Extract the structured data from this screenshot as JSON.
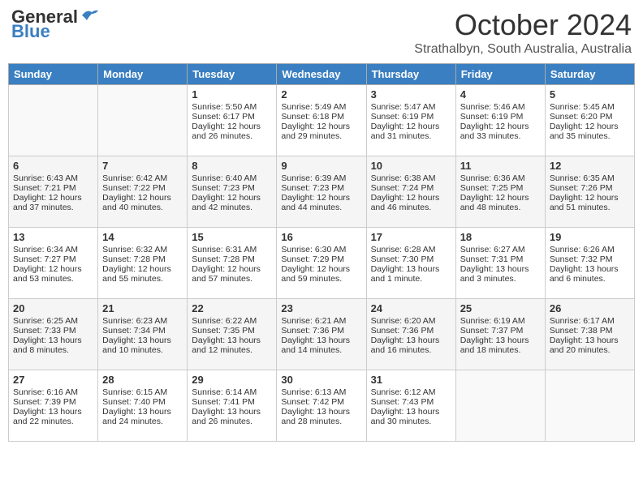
{
  "logo": {
    "general": "General",
    "blue": "Blue"
  },
  "header": {
    "month": "October 2024",
    "location": "Strathalbyn, South Australia, Australia"
  },
  "weekdays": [
    "Sunday",
    "Monday",
    "Tuesday",
    "Wednesday",
    "Thursday",
    "Friday",
    "Saturday"
  ],
  "weeks": [
    [
      {
        "day": "",
        "info": ""
      },
      {
        "day": "",
        "info": ""
      },
      {
        "day": "1",
        "info": "Sunrise: 5:50 AM\nSunset: 6:17 PM\nDaylight: 12 hours\nand 26 minutes."
      },
      {
        "day": "2",
        "info": "Sunrise: 5:49 AM\nSunset: 6:18 PM\nDaylight: 12 hours\nand 29 minutes."
      },
      {
        "day": "3",
        "info": "Sunrise: 5:47 AM\nSunset: 6:19 PM\nDaylight: 12 hours\nand 31 minutes."
      },
      {
        "day": "4",
        "info": "Sunrise: 5:46 AM\nSunset: 6:19 PM\nDaylight: 12 hours\nand 33 minutes."
      },
      {
        "day": "5",
        "info": "Sunrise: 5:45 AM\nSunset: 6:20 PM\nDaylight: 12 hours\nand 35 minutes."
      }
    ],
    [
      {
        "day": "6",
        "info": "Sunrise: 6:43 AM\nSunset: 7:21 PM\nDaylight: 12 hours\nand 37 minutes."
      },
      {
        "day": "7",
        "info": "Sunrise: 6:42 AM\nSunset: 7:22 PM\nDaylight: 12 hours\nand 40 minutes."
      },
      {
        "day": "8",
        "info": "Sunrise: 6:40 AM\nSunset: 7:23 PM\nDaylight: 12 hours\nand 42 minutes."
      },
      {
        "day": "9",
        "info": "Sunrise: 6:39 AM\nSunset: 7:23 PM\nDaylight: 12 hours\nand 44 minutes."
      },
      {
        "day": "10",
        "info": "Sunrise: 6:38 AM\nSunset: 7:24 PM\nDaylight: 12 hours\nand 46 minutes."
      },
      {
        "day": "11",
        "info": "Sunrise: 6:36 AM\nSunset: 7:25 PM\nDaylight: 12 hours\nand 48 minutes."
      },
      {
        "day": "12",
        "info": "Sunrise: 6:35 AM\nSunset: 7:26 PM\nDaylight: 12 hours\nand 51 minutes."
      }
    ],
    [
      {
        "day": "13",
        "info": "Sunrise: 6:34 AM\nSunset: 7:27 PM\nDaylight: 12 hours\nand 53 minutes."
      },
      {
        "day": "14",
        "info": "Sunrise: 6:32 AM\nSunset: 7:28 PM\nDaylight: 12 hours\nand 55 minutes."
      },
      {
        "day": "15",
        "info": "Sunrise: 6:31 AM\nSunset: 7:28 PM\nDaylight: 12 hours\nand 57 minutes."
      },
      {
        "day": "16",
        "info": "Sunrise: 6:30 AM\nSunset: 7:29 PM\nDaylight: 12 hours\nand 59 minutes."
      },
      {
        "day": "17",
        "info": "Sunrise: 6:28 AM\nSunset: 7:30 PM\nDaylight: 13 hours\nand 1 minute."
      },
      {
        "day": "18",
        "info": "Sunrise: 6:27 AM\nSunset: 7:31 PM\nDaylight: 13 hours\nand 3 minutes."
      },
      {
        "day": "19",
        "info": "Sunrise: 6:26 AM\nSunset: 7:32 PM\nDaylight: 13 hours\nand 6 minutes."
      }
    ],
    [
      {
        "day": "20",
        "info": "Sunrise: 6:25 AM\nSunset: 7:33 PM\nDaylight: 13 hours\nand 8 minutes."
      },
      {
        "day": "21",
        "info": "Sunrise: 6:23 AM\nSunset: 7:34 PM\nDaylight: 13 hours\nand 10 minutes."
      },
      {
        "day": "22",
        "info": "Sunrise: 6:22 AM\nSunset: 7:35 PM\nDaylight: 13 hours\nand 12 minutes."
      },
      {
        "day": "23",
        "info": "Sunrise: 6:21 AM\nSunset: 7:36 PM\nDaylight: 13 hours\nand 14 minutes."
      },
      {
        "day": "24",
        "info": "Sunrise: 6:20 AM\nSunset: 7:36 PM\nDaylight: 13 hours\nand 16 minutes."
      },
      {
        "day": "25",
        "info": "Sunrise: 6:19 AM\nSunset: 7:37 PM\nDaylight: 13 hours\nand 18 minutes."
      },
      {
        "day": "26",
        "info": "Sunrise: 6:17 AM\nSunset: 7:38 PM\nDaylight: 13 hours\nand 20 minutes."
      }
    ],
    [
      {
        "day": "27",
        "info": "Sunrise: 6:16 AM\nSunset: 7:39 PM\nDaylight: 13 hours\nand 22 minutes."
      },
      {
        "day": "28",
        "info": "Sunrise: 6:15 AM\nSunset: 7:40 PM\nDaylight: 13 hours\nand 24 minutes."
      },
      {
        "day": "29",
        "info": "Sunrise: 6:14 AM\nSunset: 7:41 PM\nDaylight: 13 hours\nand 26 minutes."
      },
      {
        "day": "30",
        "info": "Sunrise: 6:13 AM\nSunset: 7:42 PM\nDaylight: 13 hours\nand 28 minutes."
      },
      {
        "day": "31",
        "info": "Sunrise: 6:12 AM\nSunset: 7:43 PM\nDaylight: 13 hours\nand 30 minutes."
      },
      {
        "day": "",
        "info": ""
      },
      {
        "day": "",
        "info": ""
      }
    ]
  ]
}
